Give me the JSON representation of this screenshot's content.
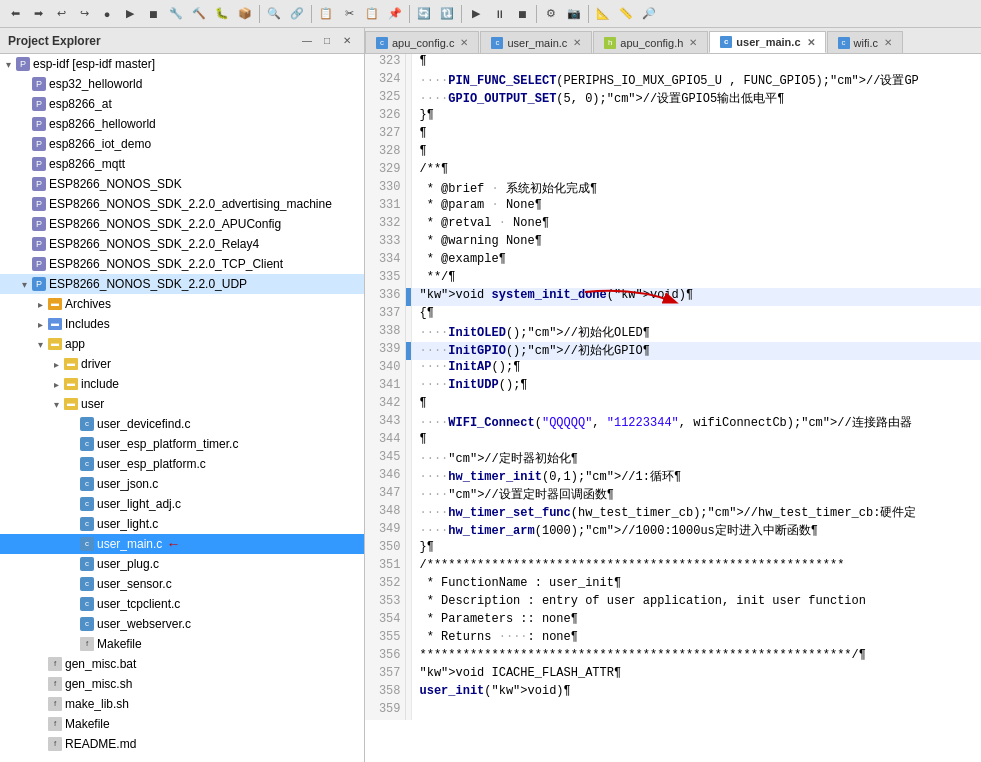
{
  "toolbar": {
    "buttons": [
      "⬅",
      "➡",
      "⬆",
      "⬇",
      "🔙",
      "🔛",
      "▶",
      "⏹",
      "🔧",
      "🔨",
      "🐛",
      "📦",
      "🔍",
      "🔗",
      "📋",
      "✂",
      "📋",
      "📌",
      "🔄",
      "🔃",
      "🔀",
      "🔁",
      "⚙",
      "📷",
      "📐",
      "📏",
      "🔎"
    ]
  },
  "left_panel": {
    "title": "Project Explorer",
    "close_label": "✕",
    "minimize_label": "—",
    "maximize_label": "□",
    "tree_items": [
      {
        "id": "esp-idf",
        "label": "esp-idf [esp-idf master]",
        "indent": 0,
        "type": "root",
        "icon": "📁",
        "expanded": true
      },
      {
        "id": "esp32_helloworld",
        "label": "esp32_helloworld",
        "indent": 1,
        "type": "project",
        "icon": "📁"
      },
      {
        "id": "esp8266_at",
        "label": "esp8266_at",
        "indent": 1,
        "type": "project",
        "icon": "📁"
      },
      {
        "id": "esp8266_helloworld",
        "label": "esp8266_helloworld",
        "indent": 1,
        "type": "project",
        "icon": "📁"
      },
      {
        "id": "esp8266_iot_demo",
        "label": "esp8266_iot_demo",
        "indent": 1,
        "type": "project",
        "icon": "📁"
      },
      {
        "id": "esp8266_mqtt",
        "label": "esp8266_mqtt",
        "indent": 1,
        "type": "project",
        "icon": "📁"
      },
      {
        "id": "ESP8266_NONOS_SDK",
        "label": "ESP8266_NONOS_SDK",
        "indent": 1,
        "type": "project",
        "icon": "🏠"
      },
      {
        "id": "ESP8266_NONOS_SDK_2.2.0_adv",
        "label": "ESP8266_NONOS_SDK_2.2.0_advertising_machine",
        "indent": 1,
        "type": "project",
        "icon": "🏠"
      },
      {
        "id": "ESP8266_NONOS_SDK_2.2.0_APU",
        "label": "ESP8266_NONOS_SDK_2.2.0_APUConfig",
        "indent": 1,
        "type": "project",
        "icon": "🏠"
      },
      {
        "id": "ESP8266_NONOS_SDK_2.2.0_Rel",
        "label": "ESP8266_NONOS_SDK_2.2.0_Relay4",
        "indent": 1,
        "type": "project",
        "icon": "🏠"
      },
      {
        "id": "ESP8266_NONOS_SDK_2.2.0_TCP",
        "label": "ESP8266_NONOS_SDK_2.2.0_TCP_Client",
        "indent": 1,
        "type": "project",
        "icon": "🏠"
      },
      {
        "id": "ESP8266_NONOS_SDK_2.2.0_UDP",
        "label": "ESP8266_NONOS_SDK_2.2.0_UDP",
        "indent": 1,
        "type": "project_selected",
        "icon": "🏠",
        "expanded": true
      },
      {
        "id": "Archives",
        "label": "Archives",
        "indent": 2,
        "type": "folder",
        "icon": "📦",
        "expanded": false
      },
      {
        "id": "Includes",
        "label": "Includes",
        "indent": 2,
        "type": "folder",
        "icon": "📂",
        "expanded": false
      },
      {
        "id": "app",
        "label": "app",
        "indent": 2,
        "type": "folder",
        "icon": "📁",
        "expanded": true
      },
      {
        "id": "driver",
        "label": "driver",
        "indent": 3,
        "type": "folder",
        "icon": "📁",
        "expanded": false
      },
      {
        "id": "include",
        "label": "include",
        "indent": 3,
        "type": "folder",
        "icon": "📁",
        "expanded": false
      },
      {
        "id": "user",
        "label": "user",
        "indent": 3,
        "type": "folder",
        "icon": "📁",
        "expanded": true
      },
      {
        "id": "user_devicefind.c",
        "label": "user_devicefind.c",
        "indent": 4,
        "type": "file",
        "icon": "c"
      },
      {
        "id": "user_esp_platform_timer.c",
        "label": "user_esp_platform_timer.c",
        "indent": 4,
        "type": "file",
        "icon": "c"
      },
      {
        "id": "user_esp_platform.c",
        "label": "user_esp_platform.c",
        "indent": 4,
        "type": "file",
        "icon": "c"
      },
      {
        "id": "user_json.c",
        "label": "user_json.c",
        "indent": 4,
        "type": "file",
        "icon": "c"
      },
      {
        "id": "user_light_adj.c",
        "label": "user_light_adj.c",
        "indent": 4,
        "type": "file",
        "icon": "c"
      },
      {
        "id": "user_light.c",
        "label": "user_light.c",
        "indent": 4,
        "type": "file",
        "icon": "c"
      },
      {
        "id": "user_main.c",
        "label": "user_main.c",
        "indent": 4,
        "type": "file",
        "icon": "c",
        "selected": true
      },
      {
        "id": "user_plug.c",
        "label": "user_plug.c",
        "indent": 4,
        "type": "file",
        "icon": "c"
      },
      {
        "id": "user_sensor.c",
        "label": "user_sensor.c",
        "indent": 4,
        "type": "file",
        "icon": "c"
      },
      {
        "id": "user_tcpclient.c",
        "label": "user_tcpclient.c",
        "indent": 4,
        "type": "file",
        "icon": "c"
      },
      {
        "id": "user_webserver.c",
        "label": "user_webserver.c",
        "indent": 4,
        "type": "file",
        "icon": "c"
      },
      {
        "id": "Makefile_user",
        "label": "Makefile",
        "indent": 4,
        "type": "file",
        "icon": "📄"
      },
      {
        "id": "gen_misc.bat",
        "label": "gen_misc.bat",
        "indent": 2,
        "type": "file",
        "icon": "📄"
      },
      {
        "id": "gen_misc.sh",
        "label": "gen_misc.sh",
        "indent": 2,
        "type": "file",
        "icon": "📄"
      },
      {
        "id": "make_lib.sh",
        "label": "make_lib.sh",
        "indent": 2,
        "type": "file",
        "icon": "📄"
      },
      {
        "id": "Makefile_root",
        "label": "Makefile",
        "indent": 2,
        "type": "file",
        "icon": "📄"
      },
      {
        "id": "README.md",
        "label": "README.md",
        "indent": 2,
        "type": "file",
        "icon": "📄"
      }
    ]
  },
  "editor": {
    "tabs": [
      {
        "id": "apu_config_c",
        "label": "apu_config.c",
        "active": false,
        "icon": "c"
      },
      {
        "id": "user_main_c_1",
        "label": "user_main.c",
        "active": false,
        "icon": "c"
      },
      {
        "id": "apu_config_h",
        "label": "apu_config.h",
        "active": false,
        "icon": "h"
      },
      {
        "id": "user_main_c_2",
        "label": "user_main.c",
        "active": true,
        "icon": "c"
      },
      {
        "id": "wifi_c",
        "label": "wifi.c",
        "active": false,
        "icon": "c"
      }
    ],
    "lines": [
      {
        "num": 323,
        "marker": "",
        "code": "¶",
        "highlight": false
      },
      {
        "num": 324,
        "marker": "",
        "code": "····PIN_FUNC_SELECT(PERIPHS_IO_MUX_GPIO5_U , FUNC_GPIO5);//设置GP",
        "highlight": false
      },
      {
        "num": 325,
        "marker": "",
        "code": "····GPIO_OUTPUT_SET(5, 0);//设置GPIO5输出低电平¶",
        "highlight": false
      },
      {
        "num": 326,
        "marker": "",
        "code": "}¶",
        "highlight": false
      },
      {
        "num": 327,
        "marker": "",
        "code": "¶",
        "highlight": false
      },
      {
        "num": 328,
        "marker": "",
        "code": "¶",
        "highlight": false
      },
      {
        "num": 329,
        "marker": "",
        "code": "/**¶",
        "highlight": false
      },
      {
        "num": 330,
        "marker": "",
        "code": " * @brief · 系统初始化完成¶",
        "highlight": false
      },
      {
        "num": 331,
        "marker": "",
        "code": " * @param · None¶",
        "highlight": false
      },
      {
        "num": 332,
        "marker": "",
        "code": " * @retval · None¶",
        "highlight": false
      },
      {
        "num": 333,
        "marker": "",
        "code": " * @warning None¶",
        "highlight": false
      },
      {
        "num": 334,
        "marker": "",
        "code": " * @example¶",
        "highlight": false
      },
      {
        "num": 335,
        "marker": "",
        "code": " **/¶",
        "highlight": false
      },
      {
        "num": 336,
        "marker": "blue",
        "code": "void system_init_done(void)¶",
        "highlight": true
      },
      {
        "num": 337,
        "marker": "",
        "code": "{¶",
        "highlight": false
      },
      {
        "num": 338,
        "marker": "",
        "code": "····InitOLED();//初始化OLED¶",
        "highlight": false
      },
      {
        "num": 339,
        "marker": "blue",
        "code": "····InitGPIO();//初始化GPIO¶",
        "highlight": true
      },
      {
        "num": 340,
        "marker": "",
        "code": "····InitAP();¶",
        "highlight": false
      },
      {
        "num": 341,
        "marker": "",
        "code": "····InitUDP();¶",
        "highlight": false
      },
      {
        "num": 342,
        "marker": "",
        "code": "¶",
        "highlight": false
      },
      {
        "num": 343,
        "marker": "",
        "code": "····WIFI_Connect(\"QQQQQ\", \"11223344\", wifiConnectCb);//连接路由器",
        "highlight": false
      },
      {
        "num": 344,
        "marker": "",
        "code": "¶",
        "highlight": false
      },
      {
        "num": 345,
        "marker": "",
        "code": "····//定时器初始化¶",
        "highlight": false
      },
      {
        "num": 346,
        "marker": "",
        "code": "····hw_timer_init(0,1);//1:循环¶",
        "highlight": false
      },
      {
        "num": 347,
        "marker": "",
        "code": "····//设置定时器回调函数¶",
        "highlight": false
      },
      {
        "num": 348,
        "marker": "",
        "code": "····hw_timer_set_func(hw_test_timer_cb);//hw_test_timer_cb:硬件定",
        "highlight": false
      },
      {
        "num": 349,
        "marker": "",
        "code": "····hw_timer_arm(1000);//1000:1000us定时进入中断函数¶",
        "highlight": false
      },
      {
        "num": 350,
        "marker": "",
        "code": "}¶",
        "highlight": false
      },
      {
        "num": 351,
        "marker": "",
        "code": "/**********************************************************",
        "highlight": false
      },
      {
        "num": 352,
        "marker": "",
        "code": " * FunctionName : user_init¶",
        "highlight": false
      },
      {
        "num": 353,
        "marker": "",
        "code": " * Description : entry of user application, init user function",
        "highlight": false
      },
      {
        "num": 354,
        "marker": "",
        "code": " * Parameters :: none¶",
        "highlight": false
      },
      {
        "num": 355,
        "marker": "",
        "code": " * Returns ····: none¶",
        "highlight": false
      },
      {
        "num": 356,
        "marker": "",
        "code": "************************************************************/¶",
        "highlight": false
      },
      {
        "num": 357,
        "marker": "",
        "code": "void ICACHE_FLASH_ATTR¶",
        "highlight": false
      },
      {
        "num": 358,
        "marker": "",
        "code": "user_init(void)¶",
        "highlight": false
      },
      {
        "num": 359,
        "marker": "",
        "code": "",
        "highlight": false
      }
    ]
  }
}
